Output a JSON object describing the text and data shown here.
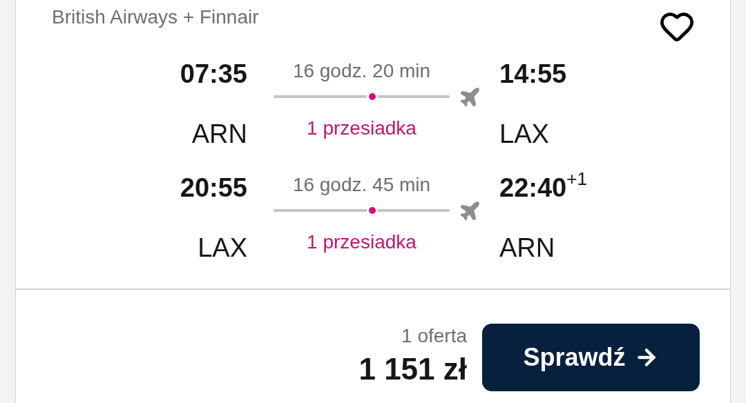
{
  "airline": "British Airways + Finnair",
  "legs": [
    {
      "departure_time": "07:35",
      "departure_airport": "ARN",
      "duration": "16 godz. 20 min",
      "stops": "1 przesiadka",
      "arrival_time": "14:55",
      "arrival_airport": "LAX"
    },
    {
      "departure_time": "20:55",
      "departure_airport": "LAX",
      "duration": "16 godz. 45 min",
      "stops": "1 przesiadka",
      "arrival_time": "22:40",
      "arrival_day_offset": "+1",
      "arrival_airport": "ARN"
    }
  ],
  "offers": "1 oferta",
  "price": "1 151 zł",
  "button": "Sprawdź"
}
